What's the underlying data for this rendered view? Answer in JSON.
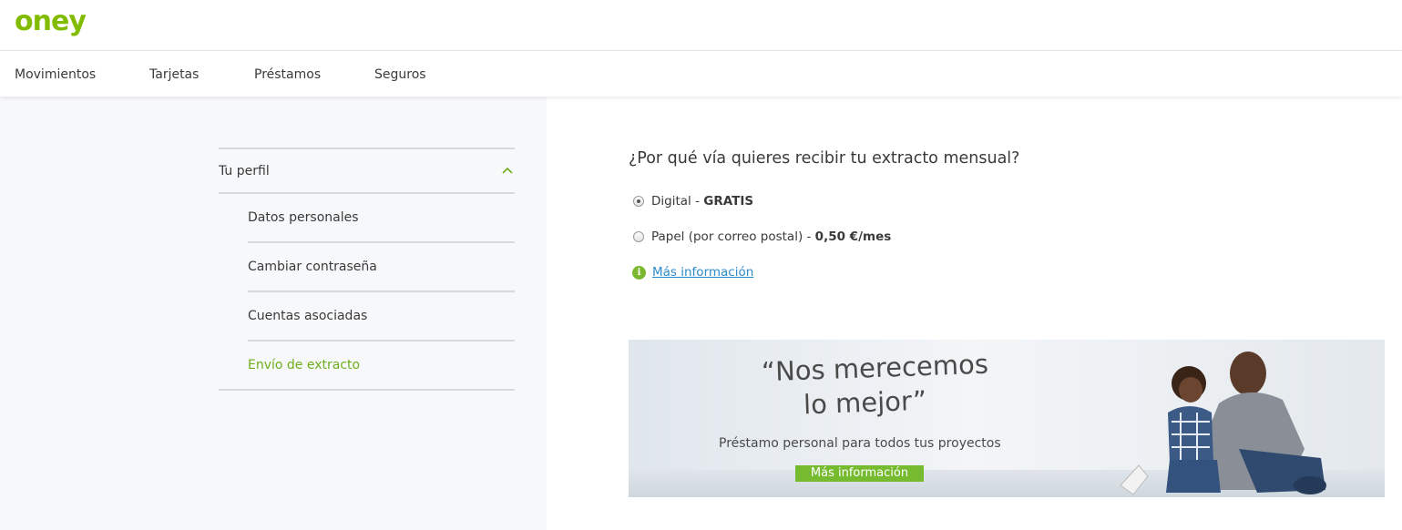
{
  "brand": {
    "logo_text": "oney",
    "color": "#81bc00"
  },
  "nav": {
    "items": [
      {
        "label": "Movimientos"
      },
      {
        "label": "Tarjetas"
      },
      {
        "label": "Préstamos"
      },
      {
        "label": "Seguros"
      }
    ]
  },
  "sidebar": {
    "section_label": "Tu perfil",
    "section_icon": "chevron-up-icon",
    "items": [
      {
        "label": "Datos personales",
        "active": false
      },
      {
        "label": "Cambiar contraseña",
        "active": false
      },
      {
        "label": "Cuentas asociadas",
        "active": false
      },
      {
        "label": "Envío de extracto",
        "active": true
      }
    ]
  },
  "main": {
    "title": "¿Por qué vía quieres recibir tu extracto mensual?",
    "options": [
      {
        "label": "Digital - ",
        "price": "GRATIS",
        "selected": true
      },
      {
        "label": "Papel (por correo postal) - ",
        "price": "0,50 €/mes",
        "selected": false
      }
    ],
    "info_icon": "info-icon",
    "info_link": "Más información"
  },
  "banner": {
    "quote_line1": "“Nos merecemos",
    "quote_line2": "lo mejor”",
    "subtitle": "Préstamo personal para todos tus proyectos",
    "cta": "Más información"
  },
  "colors": {
    "accent_green": "#76bb2f",
    "link_blue": "#2d8bc9",
    "active_text": "#6fae1e"
  }
}
